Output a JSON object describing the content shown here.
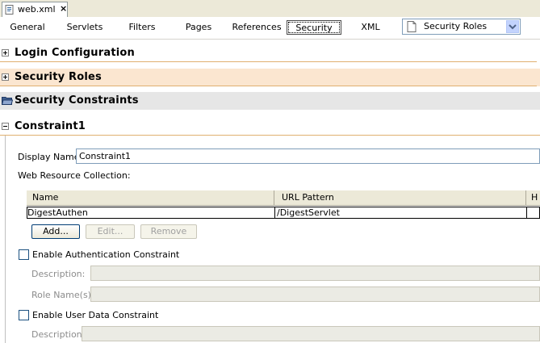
{
  "editor_tab": {
    "filename": "web.xml",
    "close": "×"
  },
  "views": {
    "buttons": [
      "General",
      "Servlets",
      "Filters",
      "Pages",
      "References",
      "Security",
      "XML"
    ],
    "active": "Security",
    "combo_value": "Security Roles"
  },
  "sections": {
    "login": "Login Configuration",
    "roles": "Security Roles",
    "constraints": "Security Constraints",
    "constraint1": "Constraint1"
  },
  "form": {
    "display_name_label": "Display Name:",
    "display_name_value": "Constraint1",
    "wrc_label": "Web Resource Collection:",
    "table": {
      "columns": [
        "Name",
        "URL Pattern",
        "H"
      ],
      "rows": [
        [
          "DigestAuthen",
          "/DigestServlet"
        ]
      ]
    },
    "add": "Add...",
    "edit": "Edit...",
    "remove": "Remove",
    "auth_constraint": "Enable Authentication Constraint",
    "description_label": "Description:",
    "role_names_label": "Role Name(s):",
    "user_data_constraint": "Enable User Data Constraint",
    "description2_label": "Description:"
  }
}
